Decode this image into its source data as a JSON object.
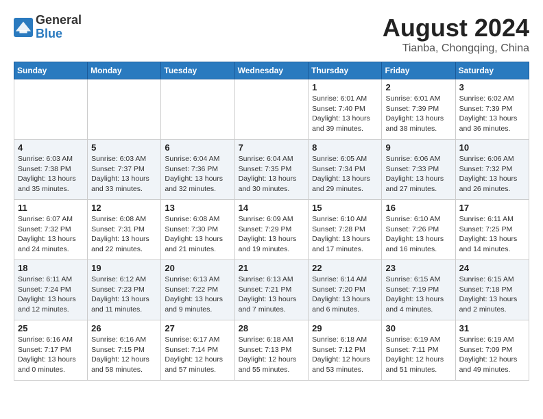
{
  "header": {
    "logo_line1": "General",
    "logo_line2": "Blue",
    "main_title": "August 2024",
    "sub_title": "Tianba, Chongqing, China"
  },
  "weekdays": [
    "Sunday",
    "Monday",
    "Tuesday",
    "Wednesday",
    "Thursday",
    "Friday",
    "Saturday"
  ],
  "weeks": [
    [
      {
        "day": "",
        "info": ""
      },
      {
        "day": "",
        "info": ""
      },
      {
        "day": "",
        "info": ""
      },
      {
        "day": "",
        "info": ""
      },
      {
        "day": "1",
        "info": "Sunrise: 6:01 AM\nSunset: 7:40 PM\nDaylight: 13 hours\nand 39 minutes."
      },
      {
        "day": "2",
        "info": "Sunrise: 6:01 AM\nSunset: 7:39 PM\nDaylight: 13 hours\nand 38 minutes."
      },
      {
        "day": "3",
        "info": "Sunrise: 6:02 AM\nSunset: 7:39 PM\nDaylight: 13 hours\nand 36 minutes."
      }
    ],
    [
      {
        "day": "4",
        "info": "Sunrise: 6:03 AM\nSunset: 7:38 PM\nDaylight: 13 hours\nand 35 minutes."
      },
      {
        "day": "5",
        "info": "Sunrise: 6:03 AM\nSunset: 7:37 PM\nDaylight: 13 hours\nand 33 minutes."
      },
      {
        "day": "6",
        "info": "Sunrise: 6:04 AM\nSunset: 7:36 PM\nDaylight: 13 hours\nand 32 minutes."
      },
      {
        "day": "7",
        "info": "Sunrise: 6:04 AM\nSunset: 7:35 PM\nDaylight: 13 hours\nand 30 minutes."
      },
      {
        "day": "8",
        "info": "Sunrise: 6:05 AM\nSunset: 7:34 PM\nDaylight: 13 hours\nand 29 minutes."
      },
      {
        "day": "9",
        "info": "Sunrise: 6:06 AM\nSunset: 7:33 PM\nDaylight: 13 hours\nand 27 minutes."
      },
      {
        "day": "10",
        "info": "Sunrise: 6:06 AM\nSunset: 7:32 PM\nDaylight: 13 hours\nand 26 minutes."
      }
    ],
    [
      {
        "day": "11",
        "info": "Sunrise: 6:07 AM\nSunset: 7:32 PM\nDaylight: 13 hours\nand 24 minutes."
      },
      {
        "day": "12",
        "info": "Sunrise: 6:08 AM\nSunset: 7:31 PM\nDaylight: 13 hours\nand 22 minutes."
      },
      {
        "day": "13",
        "info": "Sunrise: 6:08 AM\nSunset: 7:30 PM\nDaylight: 13 hours\nand 21 minutes."
      },
      {
        "day": "14",
        "info": "Sunrise: 6:09 AM\nSunset: 7:29 PM\nDaylight: 13 hours\nand 19 minutes."
      },
      {
        "day": "15",
        "info": "Sunrise: 6:10 AM\nSunset: 7:28 PM\nDaylight: 13 hours\nand 17 minutes."
      },
      {
        "day": "16",
        "info": "Sunrise: 6:10 AM\nSunset: 7:26 PM\nDaylight: 13 hours\nand 16 minutes."
      },
      {
        "day": "17",
        "info": "Sunrise: 6:11 AM\nSunset: 7:25 PM\nDaylight: 13 hours\nand 14 minutes."
      }
    ],
    [
      {
        "day": "18",
        "info": "Sunrise: 6:11 AM\nSunset: 7:24 PM\nDaylight: 13 hours\nand 12 minutes."
      },
      {
        "day": "19",
        "info": "Sunrise: 6:12 AM\nSunset: 7:23 PM\nDaylight: 13 hours\nand 11 minutes."
      },
      {
        "day": "20",
        "info": "Sunrise: 6:13 AM\nSunset: 7:22 PM\nDaylight: 13 hours\nand 9 minutes."
      },
      {
        "day": "21",
        "info": "Sunrise: 6:13 AM\nSunset: 7:21 PM\nDaylight: 13 hours\nand 7 minutes."
      },
      {
        "day": "22",
        "info": "Sunrise: 6:14 AM\nSunset: 7:20 PM\nDaylight: 13 hours\nand 6 minutes."
      },
      {
        "day": "23",
        "info": "Sunrise: 6:15 AM\nSunset: 7:19 PM\nDaylight: 13 hours\nand 4 minutes."
      },
      {
        "day": "24",
        "info": "Sunrise: 6:15 AM\nSunset: 7:18 PM\nDaylight: 13 hours\nand 2 minutes."
      }
    ],
    [
      {
        "day": "25",
        "info": "Sunrise: 6:16 AM\nSunset: 7:17 PM\nDaylight: 13 hours\nand 0 minutes."
      },
      {
        "day": "26",
        "info": "Sunrise: 6:16 AM\nSunset: 7:15 PM\nDaylight: 12 hours\nand 58 minutes."
      },
      {
        "day": "27",
        "info": "Sunrise: 6:17 AM\nSunset: 7:14 PM\nDaylight: 12 hours\nand 57 minutes."
      },
      {
        "day": "28",
        "info": "Sunrise: 6:18 AM\nSunset: 7:13 PM\nDaylight: 12 hours\nand 55 minutes."
      },
      {
        "day": "29",
        "info": "Sunrise: 6:18 AM\nSunset: 7:12 PM\nDaylight: 12 hours\nand 53 minutes."
      },
      {
        "day": "30",
        "info": "Sunrise: 6:19 AM\nSunset: 7:11 PM\nDaylight: 12 hours\nand 51 minutes."
      },
      {
        "day": "31",
        "info": "Sunrise: 6:19 AM\nSunset: 7:09 PM\nDaylight: 12 hours\nand 49 minutes."
      }
    ]
  ]
}
